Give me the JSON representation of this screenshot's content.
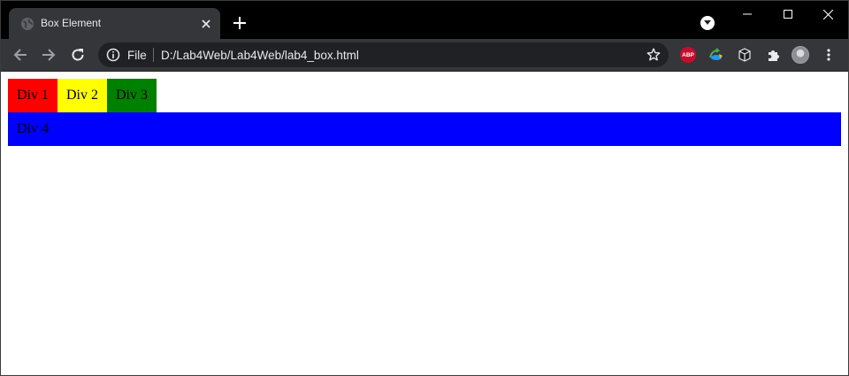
{
  "browser": {
    "tab_title": "Box Element",
    "omnibox": {
      "scheme_label": "File",
      "url": "D:/Lab4Web/Lab4Web/lab4_box.html"
    },
    "extensions": [
      {
        "name": "adblock-plus-icon",
        "label": "ABP"
      },
      {
        "name": "download-manager-icon"
      },
      {
        "name": "cube-extension-icon"
      },
      {
        "name": "puzzle-icon"
      },
      {
        "name": "profile-avatar"
      },
      {
        "name": "menu-icon"
      }
    ]
  },
  "page": {
    "boxes": [
      {
        "label": "Div 1",
        "color": "#ff0000"
      },
      {
        "label": "Div 2",
        "color": "#ffff00"
      },
      {
        "label": "Div 3",
        "color": "#008000"
      },
      {
        "label": "Div 4",
        "color": "#0000ff"
      }
    ]
  },
  "colors": {
    "tabstrip": "#000000",
    "toolbar": "#35363a",
    "omnibox": "#202124",
    "text": "#e8eaed"
  }
}
